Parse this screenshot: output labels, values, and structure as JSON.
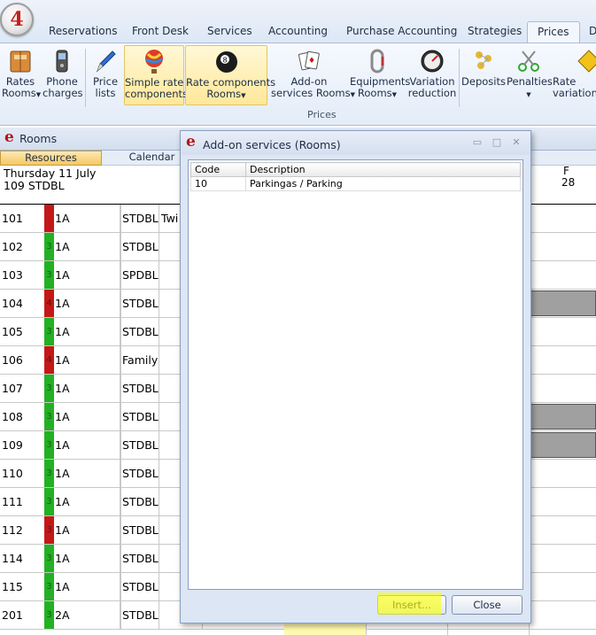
{
  "app": {
    "orb_label": "4"
  },
  "tabs": [
    {
      "label": "Reservations"
    },
    {
      "label": "Front Desk"
    },
    {
      "label": "Services"
    },
    {
      "label": "Accounting"
    },
    {
      "label": "Purchase Accounting"
    },
    {
      "label": "Strategies"
    },
    {
      "label": "Prices",
      "active": true
    },
    {
      "label": "D"
    }
  ],
  "ribbon": {
    "group_label": "Prices",
    "buttons": [
      {
        "line1": "Rates",
        "line2": "Rooms",
        "dropdown": true,
        "icon": "book-icon"
      },
      {
        "line1": "Phone",
        "line2": "charges",
        "icon": "phone-icon"
      },
      {
        "line1": "Price",
        "line2": "lists",
        "icon": "pen-icon"
      },
      {
        "line1": "Simple rate",
        "line2": "components",
        "icon": "balloon-icon",
        "selected": true
      },
      {
        "line1": "Rate components",
        "line2": "Rooms",
        "dropdown": true,
        "icon": "eight-ball-icon",
        "selected": true
      },
      {
        "line1": "Add-on",
        "line2": "services Rooms",
        "dropdown": true,
        "icon": "cards-icon"
      },
      {
        "line1": "Equipments",
        "line2": "Rooms",
        "dropdown": true,
        "icon": "carabiner-icon"
      },
      {
        "line1": "Variation",
        "line2": "reduction",
        "icon": "gauge-icon"
      },
      {
        "line1": "Deposits",
        "line2": "",
        "icon": "deposit-icon"
      },
      {
        "line1": "Penalties",
        "line2": "",
        "dropdown": true,
        "icon": "scissors-icon"
      },
      {
        "line1": "Rate",
        "line2": "variations",
        "icon": "warning-icon"
      }
    ]
  },
  "rooms_panel": {
    "title": "Rooms",
    "subtabs": [
      "Resources",
      "Calendar"
    ],
    "date_line": "Thursday 11 July",
    "room_type_line": "109 STDBL",
    "column_day": "F",
    "column_date": "28",
    "rows": [
      {
        "room": "101",
        "status": "red",
        "floor": "1A",
        "type": "STDBL",
        "desc": "Twi"
      },
      {
        "room": "102",
        "status": "green",
        "status_digit": "3",
        "floor": "1A",
        "type": "STDBL"
      },
      {
        "room": "103",
        "status": "green",
        "status_digit": "3",
        "floor": "1A",
        "type": "SPDBL"
      },
      {
        "room": "104",
        "status": "red",
        "status_digit": "4",
        "floor": "1A",
        "type": "STDBL",
        "occupied": true
      },
      {
        "room": "105",
        "status": "green",
        "status_digit": "3",
        "floor": "1A",
        "type": "STDBL"
      },
      {
        "room": "106",
        "status": "red",
        "status_digit": "4",
        "floor": "1A",
        "type": "Family"
      },
      {
        "room": "107",
        "status": "green",
        "status_digit": "3",
        "floor": "1A",
        "type": "STDBL"
      },
      {
        "room": "108",
        "status": "green",
        "status_digit": "3",
        "floor": "1A",
        "type": "STDBL",
        "occupied": true
      },
      {
        "room": "109",
        "status": "green",
        "status_digit": "3",
        "floor": "1A",
        "type": "STDBL",
        "occupied": true
      },
      {
        "room": "110",
        "status": "green",
        "status_digit": "3",
        "floor": "1A",
        "type": "STDBL"
      },
      {
        "room": "111",
        "status": "green",
        "status_digit": "3",
        "floor": "1A",
        "type": "STDBL"
      },
      {
        "room": "112",
        "status": "red",
        "status_digit": "3",
        "floor": "1A",
        "type": "STDBL"
      },
      {
        "room": "114",
        "status": "green",
        "status_digit": "3",
        "floor": "1A",
        "type": "STDBL"
      },
      {
        "room": "115",
        "status": "green",
        "status_digit": "3",
        "floor": "1A",
        "type": "STDBL"
      },
      {
        "room": "201",
        "status": "green",
        "status_digit": "3",
        "floor": "2A",
        "type": "STDBL"
      }
    ]
  },
  "dialog": {
    "title": "Add-on services (Rooms)",
    "columns": {
      "code": "Code",
      "description": "Description"
    },
    "rows": [
      {
        "code": "10",
        "description": "Parkingas / Parking"
      }
    ],
    "insert_label": "Insert...",
    "close_label": "Close"
  },
  "colors": {
    "status_red": "#c41818",
    "status_green": "#22b122",
    "brand_red": "#b7151b",
    "highlight_yellow": "#faff00"
  }
}
